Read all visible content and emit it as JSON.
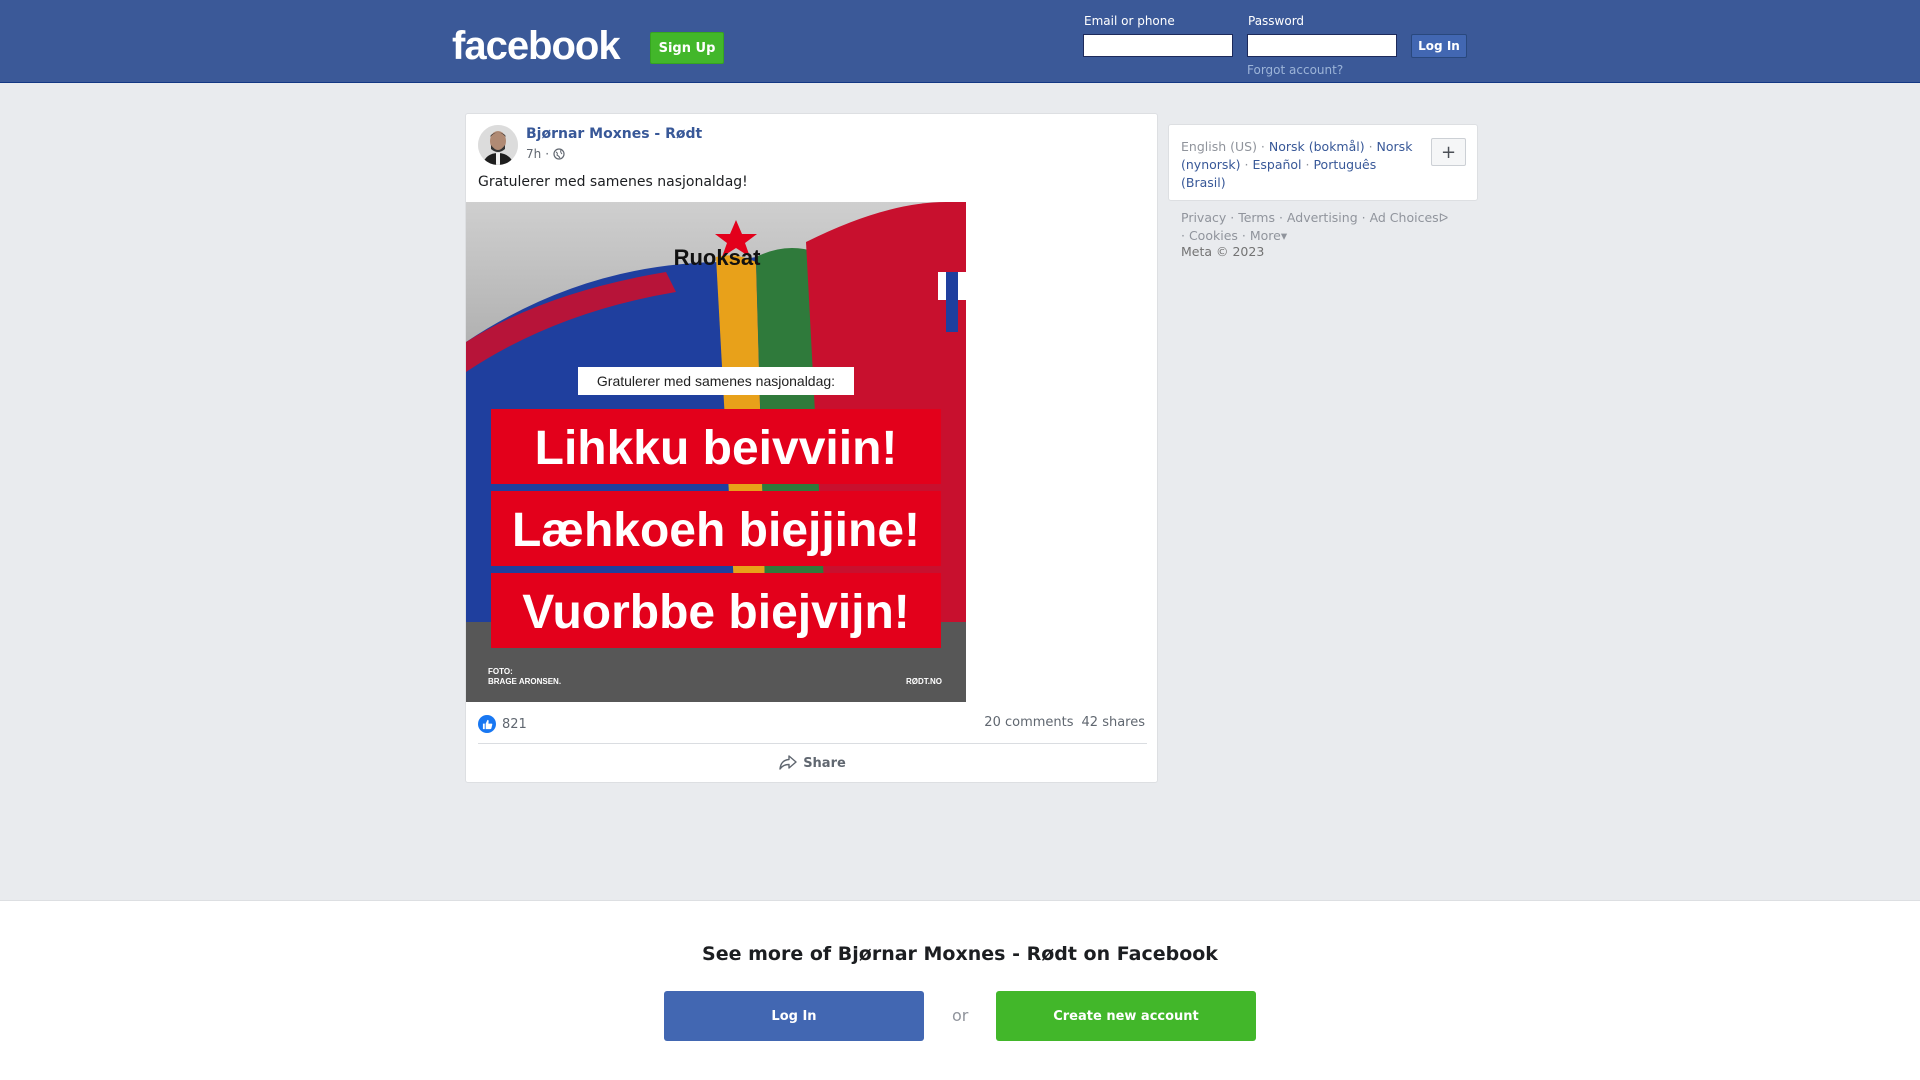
{
  "header": {
    "logo": "facebook",
    "signup_label": "Sign Up",
    "email_label": "Email or phone",
    "password_label": "Password",
    "login_label": "Log In",
    "forgot_label": "Forgot account?"
  },
  "post": {
    "author": "Bjørnar Moxnes - Rødt",
    "time": "7h",
    "audience_icon": "globe-icon",
    "text": "Gratulerer med samenes nasjonaldag!",
    "image": {
      "brand": "Ruoksat",
      "caption": "Gratulerer med samenes nasjonaldag:",
      "lines": [
        "Lihkku beivviin!",
        "Læhkoeh biejjine!",
        "Vuorbbe biejvijn!"
      ],
      "photo_credit_1": "FOTO:",
      "photo_credit_2": "BRAGE ARONSEN.",
      "site": "RØDT.NO"
    },
    "likes": "821",
    "comments": "20 comments",
    "shares": "42 shares",
    "share_label": "Share"
  },
  "sidebar": {
    "languages": [
      "English (US)",
      "Norsk (bokmål)",
      "Norsk (nynorsk)",
      "Español",
      "Português (Brasil)"
    ],
    "footer_links": [
      "Privacy",
      "Terms",
      "Advertising",
      "Ad Choices",
      "Cookies",
      "More"
    ],
    "copyright": "Meta © 2023"
  },
  "bottom": {
    "title": "See more of Bjørnar Moxnes - Rødt on Facebook",
    "login_label": "Log In",
    "or_label": "or",
    "create_label": "Create new account"
  },
  "colors": {
    "brand_blue": "#3b5998",
    "green": "#42b72a",
    "link": "#385898"
  }
}
